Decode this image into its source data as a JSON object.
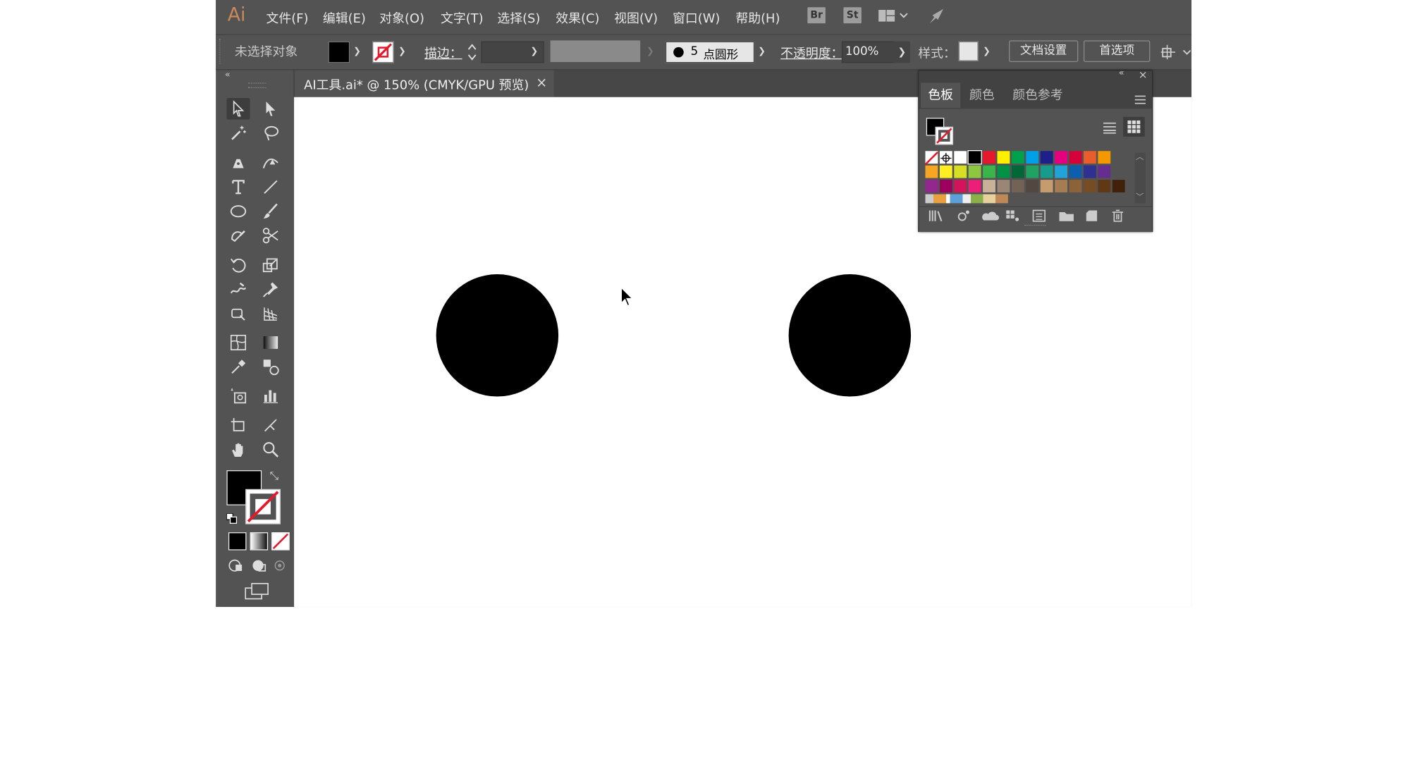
{
  "app": {
    "logo": "Ai",
    "menu": [
      "文件(F)",
      "编辑(E)",
      "对象(O)",
      "文字(T)",
      "选择(S)",
      "效果(C)",
      "视图(V)",
      "窗口(W)",
      "帮助(H)"
    ],
    "bridge_label": "Br",
    "stock_label": "St"
  },
  "control": {
    "selection_state": "未选择对象",
    "stroke_label": "描边：",
    "brush_value": "5",
    "brush_label": "点圆形",
    "opacity_label": "不透明度：",
    "opacity_value": "100%",
    "style_label": "样式：",
    "doc_setup_button": "文档设置",
    "prefs_button": "首选项"
  },
  "document": {
    "tab_title": "AI工具.ai* @ 150% (CMYK/GPU 预览)",
    "close_glyph": "×"
  },
  "swatches_panel": {
    "tabs": [
      "色板",
      "颜色",
      "颜色参考"
    ],
    "active_tab": "色板",
    "swatch_rows": [
      [
        "none",
        "register",
        "#ffffff",
        "#000000",
        "#e5182c",
        "#fff000",
        "#00a04c",
        "#00a0e9",
        "#1d2088",
        "#e4007f",
        "#d6003a",
        "#e95c2b",
        "#f39800"
      ],
      [
        "#f6a623",
        "#fcee21",
        "#d7df23",
        "#8dc63f",
        "#39b54a",
        "#009245",
        "#006837",
        "#1fa363",
        "#169b8c",
        "#22a3d8",
        "#0b5fad",
        "#2e3192",
        "#662d91"
      ],
      [
        "#93278f",
        "#9e005d",
        "#d4145a",
        "#ed1e79",
        "#c7b299",
        "#998675",
        "#736357",
        "#534741",
        "#c69c6d",
        "#a67c52",
        "#8c6239",
        "#754c24",
        "#603813",
        "#42210b"
      ]
    ]
  },
  "canvas": {
    "shapes": [
      "circle",
      "circle"
    ],
    "fill_color": "#000000"
  },
  "colors": {
    "ui_dark": "#535353",
    "ui_darker": "#474747",
    "accent_logo": "#c9895b",
    "none_slash": "#e5182c"
  }
}
